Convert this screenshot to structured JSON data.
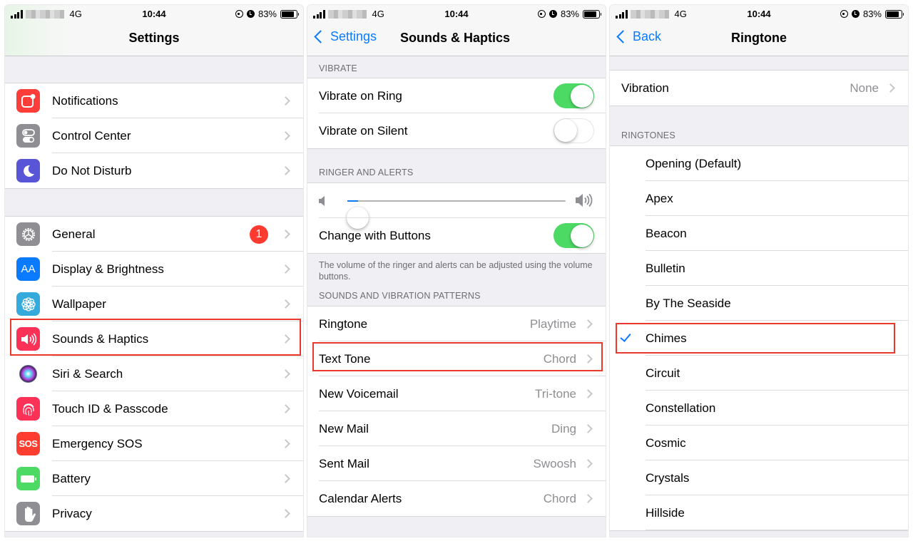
{
  "status_bar": {
    "network": "4G",
    "time": "10:44",
    "battery_percent": "83%",
    "battery_level": 0.83
  },
  "screens": [
    {
      "id": "settings",
      "nav": {
        "title": "Settings"
      },
      "groups": [
        {
          "items": [
            {
              "label": "Notifications",
              "icon": "notifications-icon",
              "color": "#fc3d39"
            },
            {
              "label": "Control Center",
              "icon": "control-center-icon",
              "color": "#8e8e93"
            },
            {
              "label": "Do Not Disturb",
              "icon": "moon-icon",
              "color": "#5856d6"
            }
          ]
        },
        {
          "items": [
            {
              "label": "General",
              "icon": "gear-icon",
              "color": "#8e8e93",
              "badge": "1"
            },
            {
              "label": "Display & Brightness",
              "icon": "text-size-icon",
              "color": "#0a7aff",
              "icon_text": "AA"
            },
            {
              "label": "Wallpaper",
              "icon": "flower-icon",
              "color": "#35aadc"
            },
            {
              "label": "Sounds & Haptics",
              "icon": "speaker-icon",
              "color": "#fc3158",
              "highlighted": true
            },
            {
              "label": "Siri & Search",
              "icon": "siri-icon",
              "color": "#1f1f3d"
            },
            {
              "label": "Touch ID & Passcode",
              "icon": "fingerprint-icon",
              "color": "#fc3158"
            },
            {
              "label": "Emergency SOS",
              "icon": "sos-icon",
              "color": "#fd3d2f",
              "icon_text": "SOS"
            },
            {
              "label": "Battery",
              "icon": "battery-icon",
              "color": "#4cd964"
            },
            {
              "label": "Privacy",
              "icon": "hand-icon",
              "color": "#8e8e93"
            }
          ]
        }
      ]
    },
    {
      "id": "sounds-haptics",
      "nav": {
        "back": "Settings",
        "title": "Sounds & Haptics"
      },
      "vibrate": {
        "header": "VIBRATE",
        "items": [
          {
            "label": "Vibrate on Ring",
            "on": true
          },
          {
            "label": "Vibrate on Silent",
            "on": false
          }
        ]
      },
      "ringer": {
        "header": "RINGER AND ALERTS",
        "volume": 0.05,
        "change_with_buttons": {
          "label": "Change with Buttons",
          "on": true
        },
        "footnote": "The volume of the ringer and alerts can be adjusted using the volume buttons."
      },
      "patterns": {
        "header": "SOUNDS AND VIBRATION PATTERNS",
        "items": [
          {
            "label": "Ringtone",
            "value": "Playtime",
            "highlighted": true
          },
          {
            "label": "Text Tone",
            "value": "Chord"
          },
          {
            "label": "New Voicemail",
            "value": "Tri-tone"
          },
          {
            "label": "New Mail",
            "value": "Ding"
          },
          {
            "label": "Sent Mail",
            "value": "Swoosh"
          },
          {
            "label": "Calendar Alerts",
            "value": "Chord"
          }
        ]
      }
    },
    {
      "id": "ringtone",
      "nav": {
        "back": "Back",
        "title": "Ringtone"
      },
      "vibration": {
        "label": "Vibration",
        "value": "None"
      },
      "ringtones": {
        "header": "RINGTONES",
        "selected": "Chimes",
        "items": [
          "Opening (Default)",
          "Apex",
          "Beacon",
          "Bulletin",
          "By The Seaside",
          "Chimes",
          "Circuit",
          "Constellation",
          "Cosmic",
          "Crystals",
          "Hillside"
        ]
      }
    }
  ],
  "colors": {
    "accent": "#0a7aff",
    "toggle_on": "#4cd964",
    "highlight_box": "#e8392c",
    "badge": "#ff3b30"
  }
}
